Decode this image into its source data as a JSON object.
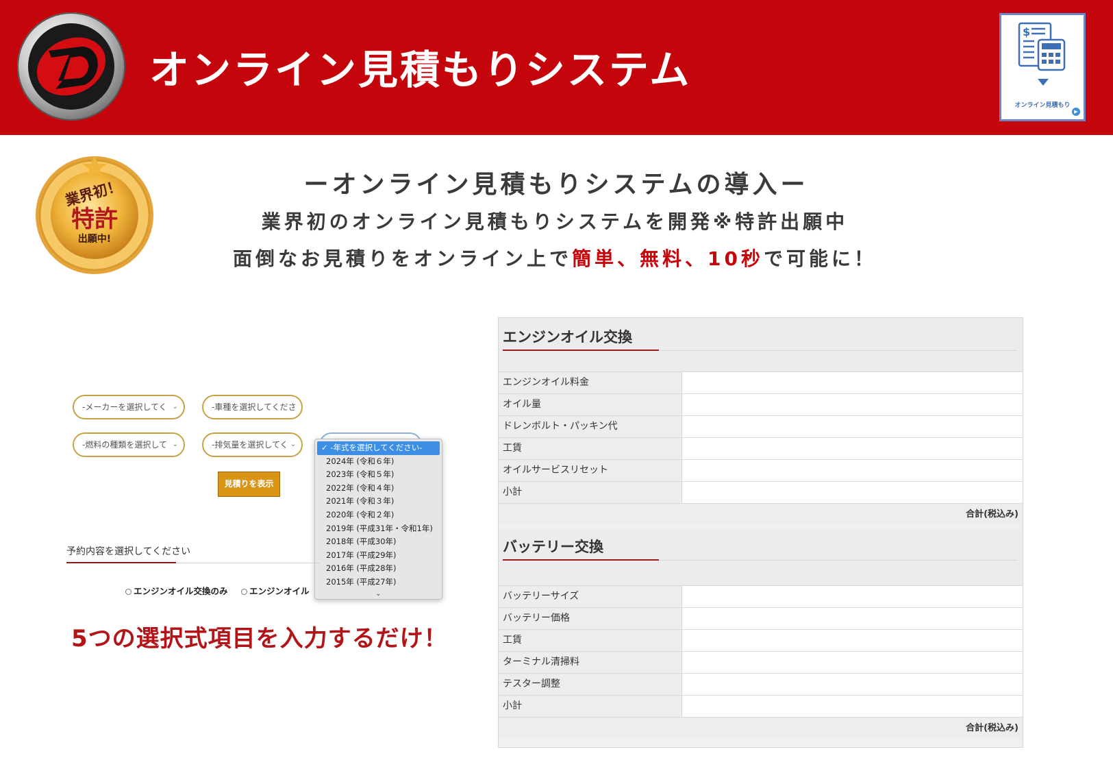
{
  "header": {
    "title": "オンライン見積もりシステム",
    "logo_letter": "D",
    "widget": {
      "label": "オンライン見積もり",
      "icon": "calculator-invoice-icon"
    }
  },
  "badge": {
    "line1": "業界初！",
    "line2": "特許",
    "line3": "出願中!"
  },
  "intro": {
    "title": "ーオンライン見積もりシステムの導入ー",
    "subtitle": "業界初のオンライン見積もりシステムを開発※特許出願中",
    "line3_prefix": "面倒なお見積りをオンライン上で",
    "line3_highlight": "簡単、無料、10秒",
    "line3_suffix": "で可能に！"
  },
  "form": {
    "maker_select": "-メーカーを選択してく",
    "model_select": "-車種を選択してくださ",
    "fuel_select": "-燃料の種類を選択して",
    "displacement_select": "-排気量を選択してく",
    "year_options": [
      "✓ -年式を選択してください-",
      "2024年 (令和６年)",
      "2023年 (令和５年)",
      "2022年 (令和４年)",
      "2021年 (令和３年)",
      "2020年 (令和２年)",
      "2019年 (平成31年・令和1年)",
      "2018年 (平成30年)",
      "2017年 (平成29年)",
      "2016年 (平成28年)",
      "2015年 (平成27年)"
    ],
    "scroll_more": "⌄",
    "show_button": "見積りを表示",
    "reserve_label": "予約内容を選択してください",
    "radio_1": "エンジンオイル交換のみ",
    "radio_2": "エンジンオイル"
  },
  "note": "5つの選択式項目を入力するだけ！",
  "tables": {
    "oil": {
      "title": "エンジンオイル交換",
      "rows": [
        "エンジンオイル料金",
        "オイル量",
        "ドレンボルト・パッキン代",
        "工賃",
        "オイルサービスリセット",
        "小計"
      ],
      "total": "合計(税込み)"
    },
    "battery": {
      "title": "バッテリー交換",
      "rows": [
        "バッテリーサイズ",
        "バッテリー価格",
        "工賃",
        "ターミナル清掃料",
        "テスター調整",
        "小計"
      ],
      "total": "合計(税込み)"
    }
  },
  "colors": {
    "brand_red": "#c4050b",
    "gold_border": "#c9a146",
    "button_orange": "#d99416",
    "select_highlight": "#3d8fe6"
  }
}
